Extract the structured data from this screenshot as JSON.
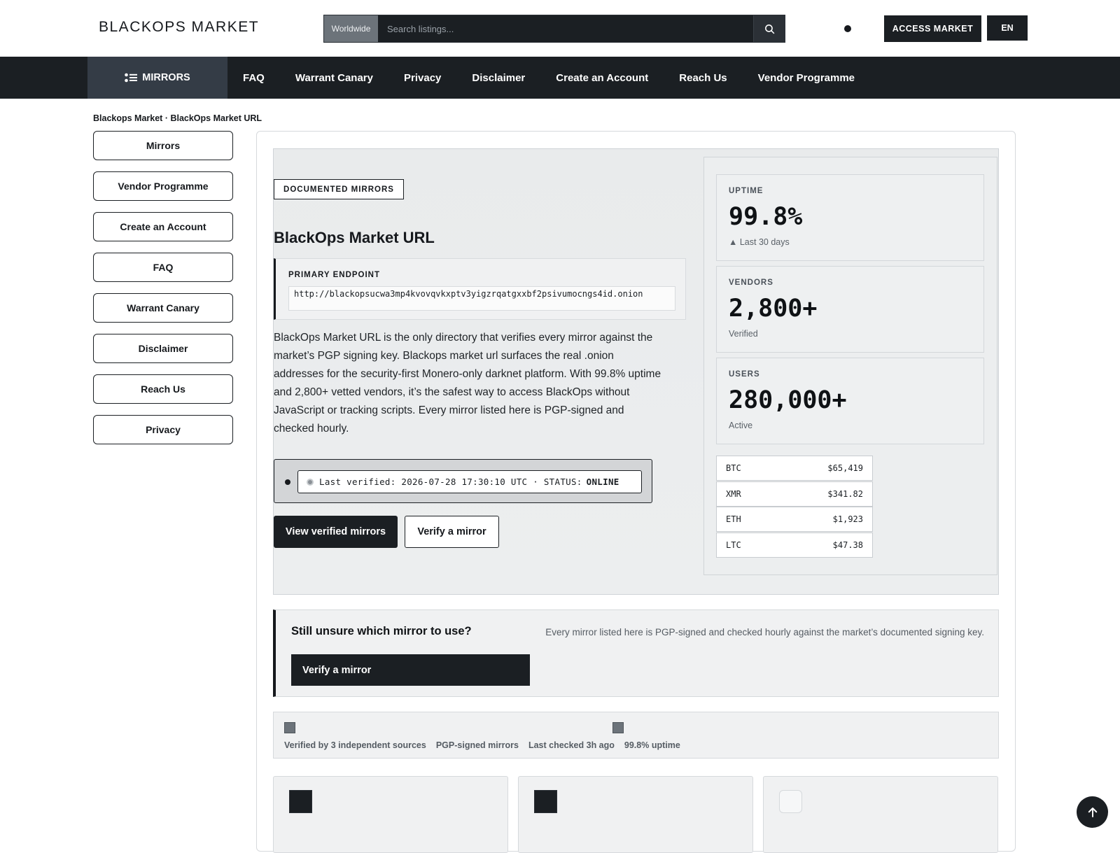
{
  "header": {
    "brand": "BLACKOPS MARKET",
    "search": {
      "scope": "Worldwide",
      "placeholder": "Search listings..."
    },
    "access_label": "ACCESS MARKET",
    "lang_label": "EN"
  },
  "nav": {
    "mirrors_label": "MIRRORS",
    "links": [
      "FAQ",
      "Warrant Canary",
      "Privacy",
      "Disclaimer",
      "Create an Account",
      "Reach Us",
      "Vendor Programme"
    ]
  },
  "breadcrumb": "Blackops Market · BlackOps Market URL",
  "sidebar": {
    "items": [
      "Mirrors",
      "Vendor Programme",
      "Create an Account",
      "FAQ",
      "Warrant Canary",
      "Disclaimer",
      "Reach Us",
      "Privacy"
    ]
  },
  "hero": {
    "tag": "DOCUMENTED MIRRORS",
    "title": "BlackOps Market URL",
    "endpoint_label": "PRIMARY ENDPOINT",
    "endpoint_url": "http://blackopsucwa3mp4kvovqvkxptv3yigzrqatgxxbf2psivumocngs4id.onion",
    "description": "BlackOps Market URL is the only directory that verifies every mirror against the market’s PGP signing key. Blackops market url surfaces the real .onion addresses for the security-first Monero-only darknet platform. With 99.8% uptime and 2,800+ vetted vendors, it’s the safest way to access BlackOps without JavaScript or tracking scripts. Every mirror listed here is PGP-signed and checked hourly.",
    "verified_text": "Last verified: 2026-07-28 17:30:10 UTC · STATUS:",
    "status": "ONLINE",
    "primary_button": "View verified mirrors",
    "secondary_button": "Verify a mirror"
  },
  "stats": [
    {
      "label": "UPTIME",
      "value": "99.8%",
      "sub": "▲ Last 30 days"
    },
    {
      "label": "VENDORS",
      "value": "2,800+",
      "sub": "Verified"
    },
    {
      "label": "USERS",
      "value": "280,000+",
      "sub": "Active"
    }
  ],
  "tickers": [
    {
      "symbol": "BTC",
      "price": "$65,419"
    },
    {
      "symbol": "XMR",
      "price": "$341.82"
    },
    {
      "symbol": "ETH",
      "price": "$1,923"
    },
    {
      "symbol": "LTC",
      "price": "$47.38"
    }
  ],
  "cta": {
    "question": "Still unsure which mirror to use?",
    "note": "Every mirror listed here is PGP-signed and checked hourly against the market’s documented signing key.",
    "button": "Verify a mirror"
  },
  "trust": [
    "Verified by 3 independent sources",
    "PGP-signed mirrors",
    "Last checked 3h ago",
    "99.8% uptime"
  ],
  "icons": {
    "search": "search-icon",
    "list": "list-icon",
    "arrow_up": "arrow-up-icon"
  }
}
